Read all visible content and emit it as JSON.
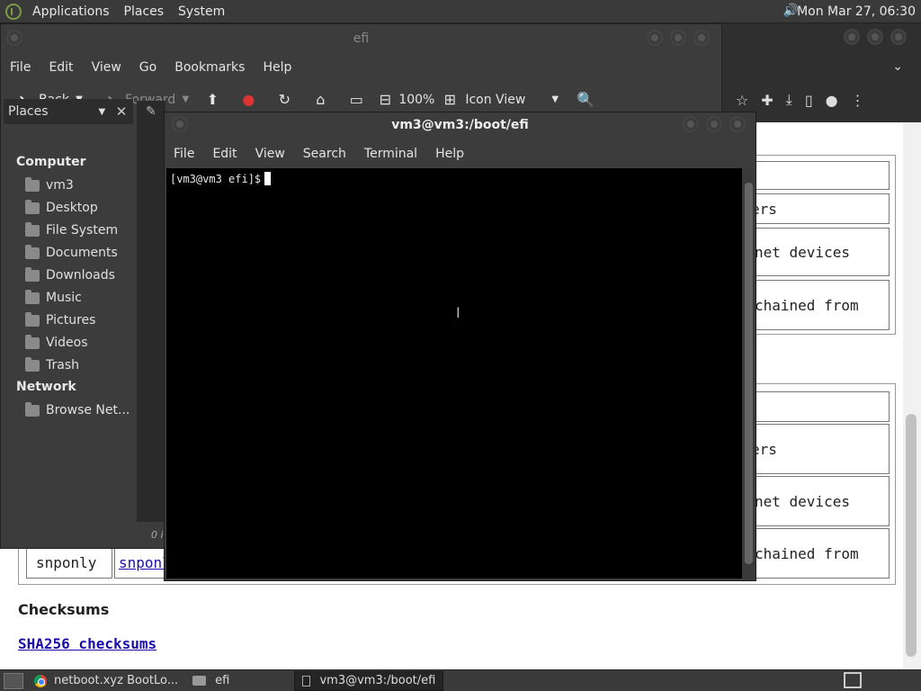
{
  "top_panel": {
    "menus": [
      "Applications",
      "Places",
      "System"
    ],
    "clock": "Mon Mar 27, 06:30"
  },
  "browser": {
    "table1": [
      "ers",
      "net devices",
      "chained from"
    ],
    "table2": [
      "ers",
      "net devices",
      "chained from"
    ],
    "snponly_cell": "snponly",
    "snponly_link": "snponl",
    "checksums_heading": "Checksums",
    "sha_link": "SHA256 checksums"
  },
  "file_manager": {
    "title": "efi",
    "menus": [
      "File",
      "Edit",
      "View",
      "Go",
      "Bookmarks",
      "Help"
    ],
    "toolbar": {
      "back": "Back",
      "forward": "Forward",
      "zoom": "100%",
      "view_mode": "Icon View"
    },
    "places_label": "Places",
    "sidebar": {
      "computer_heading": "Computer",
      "computer_items": [
        "vm3",
        "Desktop",
        "File System",
        "Documents",
        "Downloads",
        "Music",
        "Pictures",
        "Videos",
        "Trash"
      ],
      "network_heading": "Network",
      "network_items": [
        "Browse Net..."
      ]
    },
    "status": "0 i"
  },
  "terminal": {
    "title": "vm3@vm3:/boot/efi",
    "menus": [
      "File",
      "Edit",
      "View",
      "Search",
      "Terminal",
      "Help"
    ],
    "prompt": "[vm3@vm3 efi]$"
  },
  "taskbar": {
    "tasks": [
      "netboot.xyz BootLo...",
      "efi",
      "vm3@vm3:/boot/efi"
    ]
  }
}
